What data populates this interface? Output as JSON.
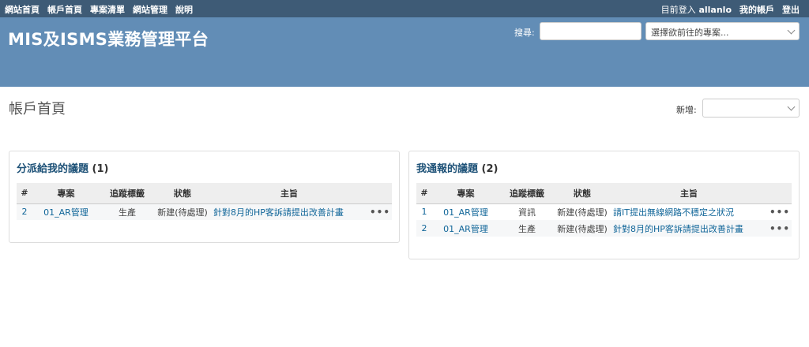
{
  "top_menu": {
    "left_items": [
      "網站首頁",
      "帳戶首頁",
      "專案清單",
      "網站管理",
      "說明"
    ],
    "login_text": "目前登入",
    "login_user": "allanlo",
    "my_account": "我的帳戶",
    "logout": "登出"
  },
  "header": {
    "title": "MIS及ISMS業務管理平台",
    "search_label": "搜尋:",
    "search_value": "",
    "project_jump_placeholder": "選擇欲前往的專案..."
  },
  "page": {
    "title": "帳戶首頁",
    "new_label": "新增:"
  },
  "assigned_box": {
    "title": "分派給我的議題",
    "count": "(1)",
    "columns": [
      "#",
      "專案",
      "追蹤標籤",
      "狀態",
      "主旨"
    ],
    "rows": [
      {
        "id": "2",
        "project": "01_AR管理",
        "tracker": "生產",
        "status": "新建(待處理)",
        "subject": "針對8月的HP客訴請提出改善計畫",
        "more": "•••"
      }
    ]
  },
  "reported_box": {
    "title": "我通報的議題",
    "count": "(2)",
    "columns": [
      "#",
      "專案",
      "追蹤標籤",
      "狀態",
      "主旨"
    ],
    "rows": [
      {
        "id": "1",
        "project": "01_AR管理",
        "tracker": "資訊",
        "status": "新建(待處理)",
        "subject": "請IT提出無線網路不穩定之狀況",
        "more": "•••"
      },
      {
        "id": "2",
        "project": "01_AR管理",
        "tracker": "生產",
        "status": "新建(待處理)",
        "subject": "針對8月的HP客訴請提出改善計畫",
        "more": "•••"
      }
    ]
  },
  "colors": {
    "top_menu_bg": "#3e5b76",
    "header_bg": "#628db6",
    "link": "#116699",
    "box_title": "#1d5177"
  }
}
